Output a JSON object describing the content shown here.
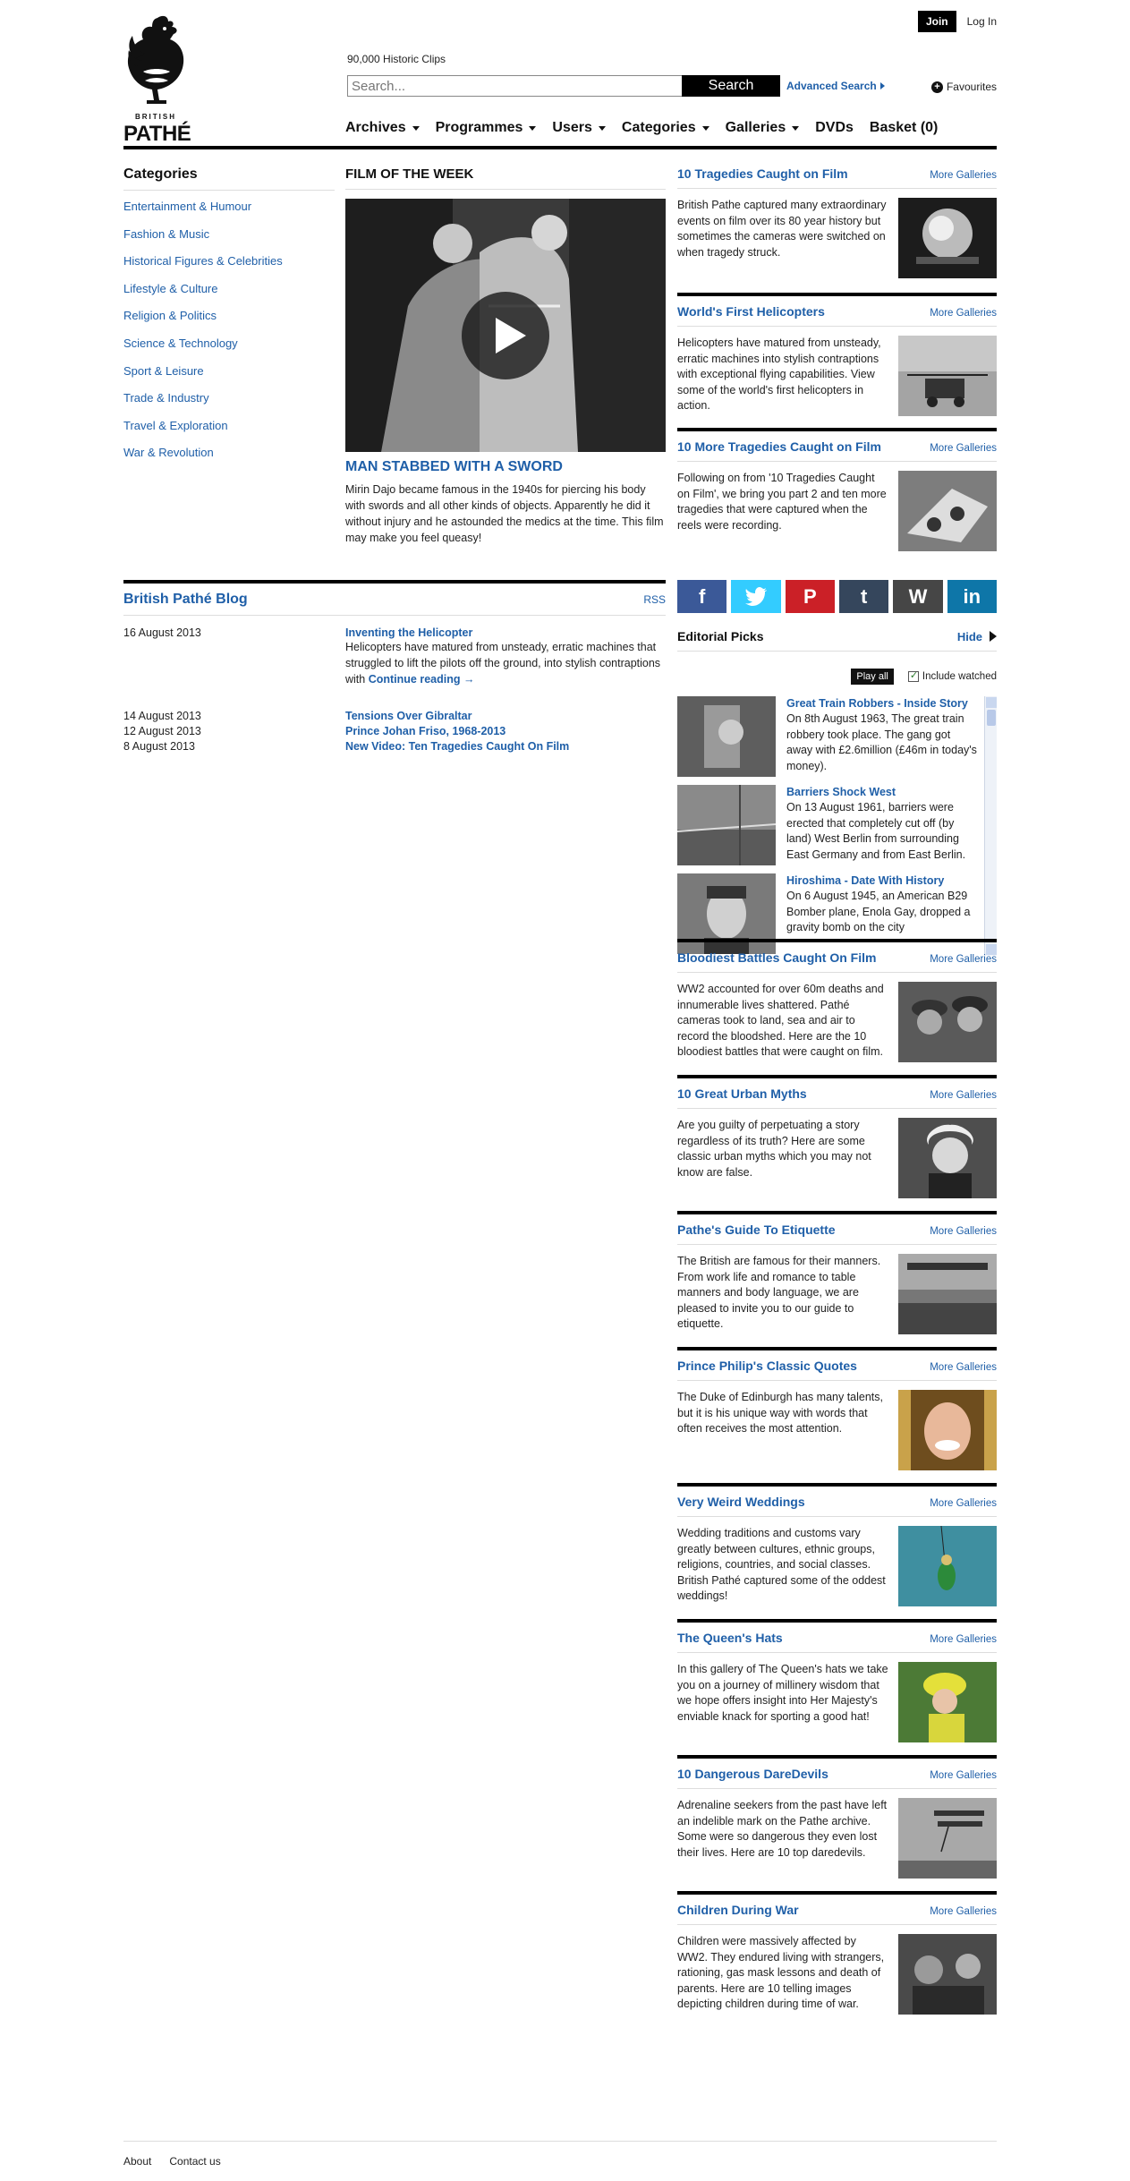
{
  "header": {
    "logo_top": "BRITISH",
    "logo_main": "PATHÉ",
    "join_label": "Join",
    "login_label": "Log In",
    "clips_count": "90,000 Historic Clips",
    "search_placeholder": "Search...",
    "search_button": "Search",
    "advanced_search": "Advanced Search",
    "favourites": "Favourites",
    "nav": [
      "Archives",
      "Programmes",
      "Users",
      "Categories",
      "Galleries",
      "DVDs",
      "Basket (0)"
    ]
  },
  "categories": {
    "title": "Categories",
    "items": [
      "Entertainment & Humour",
      "Fashion & Music",
      "Historical Figures & Celebrities",
      "Lifestyle & Culture",
      "Religion & Politics",
      "Science & Technology",
      "Sport & Leisure",
      "Trade & Industry",
      "Travel & Exploration",
      "War & Revolution"
    ]
  },
  "film_of_week": {
    "section_title": "FILM OF THE WEEK",
    "headline": "MAN STABBED WITH A SWORD",
    "description": "Mirin Dajo became famous in the 1940s for piercing his body with swords and all other kinds of objects. Apparently he did it without injury and he astounded the medics at the time. This film may make you feel queasy!"
  },
  "blog": {
    "title": "British Pathé Blog",
    "rss": "RSS",
    "featured": {
      "date": "16 August 2013",
      "title": "Inventing the Helicopter",
      "excerpt": "Helicopters have matured from unsteady, erratic machines that struggled to lift the pilots off the ground, into stylish contraptions with",
      "continue": "Continue reading →"
    },
    "posts": [
      {
        "date": "14 August 2013",
        "title": "Tensions Over Gibraltar"
      },
      {
        "date": "12 August 2013",
        "title": "Prince Johan Friso, 1968-2013"
      },
      {
        "date": "8 August 2013",
        "title": "New Video: Ten Tragedies Caught On Film"
      }
    ]
  },
  "more_galleries_label": "More Galleries",
  "galleries_top": [
    {
      "title": "10 Tragedies Caught on Film",
      "text": "British Pathe captured many extraordinary events on film over its 80 year history but sometimes the cameras were switched on when tragedy struck."
    },
    {
      "title": "World's First Helicopters",
      "text": "Helicopters have matured from unsteady, erratic machines into stylish contraptions with exceptional flying capabilities. View some of the world's first helicopters in action."
    },
    {
      "title": "10 More Tragedies Caught on Film",
      "text": "Following on from '10 Tragedies Caught on Film', we bring you part 2 and ten more tragedies that were captured when the reels were recording."
    }
  ],
  "social": {
    "facebook": "f",
    "twitter": "twitter-icon",
    "pinterest": "P",
    "tumblr": "t",
    "wordpress": "W",
    "linkedin": "in"
  },
  "editorial": {
    "title": "Editorial Picks",
    "hide": "Hide",
    "play_all": "Play all",
    "include_watched": "Include watched",
    "items": [
      {
        "title": "Great Train Robbers - Inside Story",
        "desc": "On 8th August 1963, The great train robbery took place. The gang got away with £2.6million (£46m in today's money)."
      },
      {
        "title": "Barriers Shock West",
        "desc": "On 13 August 1961, barriers were erected that completely cut off (by land) West Berlin from surrounding East Germany and from East Berlin."
      },
      {
        "title": "Hiroshima - Date With History",
        "desc": "On 6 August 1945, an American B29 Bomber plane, Enola Gay, dropped a gravity bomb on the city"
      }
    ]
  },
  "galleries_bottom": [
    {
      "title": "Bloodiest Battles Caught On Film",
      "text": "WW2 accounted for over 60m deaths and innumerable lives shattered. Pathé cameras took to land, sea and air to record the bloodshed. Here are the 10 bloodiest battles that were caught on film."
    },
    {
      "title": "10 Great Urban Myths",
      "text": "Are you guilty of perpetuating a story regardless of its truth? Here are some classic urban myths which you may not know are false."
    },
    {
      "title": "Pathe's Guide To Etiquette",
      "text": "The British are famous for their manners. From work life and romance to table manners and body language, we are pleased to invite you to our guide to etiquette."
    },
    {
      "title": "Prince Philip's Classic Quotes",
      "text": "The Duke of Edinburgh has many talents, but it is his unique way with words that often receives the most attention."
    },
    {
      "title": "Very Weird Weddings",
      "text": "Wedding traditions and customs vary greatly between cultures, ethnic groups, religions, countries, and social classes. British Pathé captured some of the oddest weddings!"
    },
    {
      "title": "The Queen's Hats",
      "text": "In this gallery of The Queen's hats we take you on a journey of millinery wisdom that we hope offers insight into Her Majesty's enviable knack for sporting a good hat!"
    },
    {
      "title": "10 Dangerous DareDevils",
      "text": "Adrenaline seekers from the past have left an indelible mark on the Pathe archive. Some were so dangerous they even lost their lives. Here are 10 top daredevils."
    },
    {
      "title": "Children During War",
      "text": "Children were massively affected by WW2. They endured living with strangers, rationing, gas mask lessons and death of parents. Here are 10 telling images depicting children during time of war."
    }
  ],
  "footer": {
    "about": "About",
    "contact": "Contact us"
  }
}
